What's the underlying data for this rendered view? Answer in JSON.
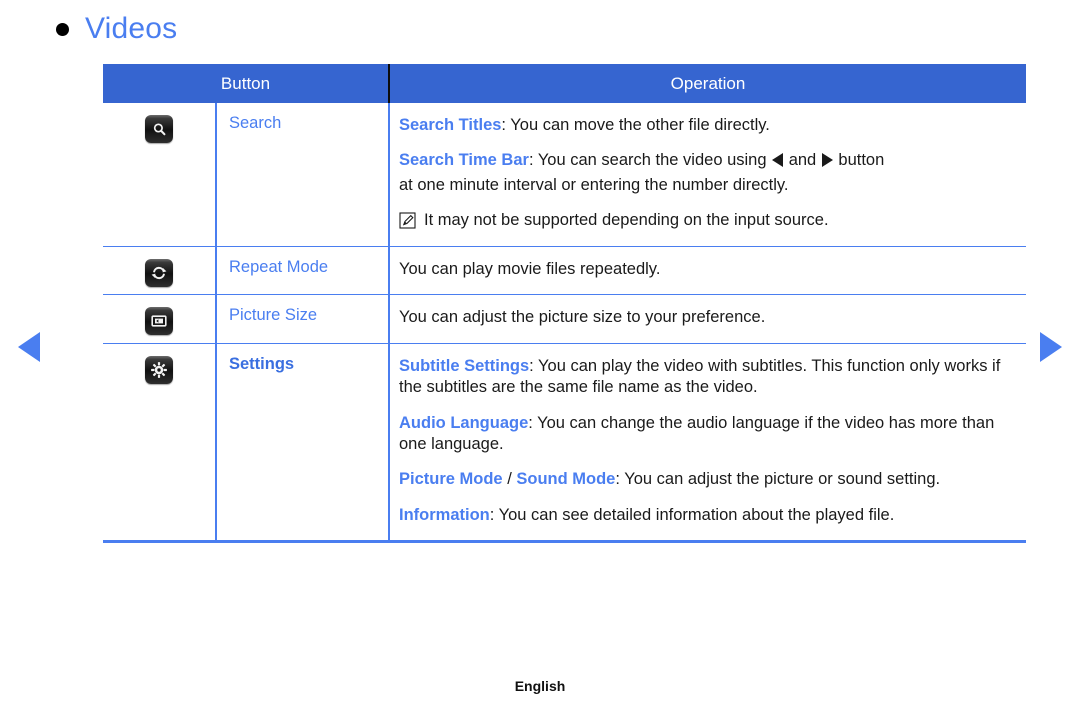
{
  "page": {
    "title": "Videos",
    "bullet_icon": "bullet-dot",
    "footer_label": "English",
    "accent_color": "#4a7ef0",
    "header_bg_color": "#3665d0",
    "header_text_color": "#ffffff",
    "body_text_color": "#1a1a1a"
  },
  "navigation": {
    "prev_icon": "triangle-left-icon",
    "next_icon": "triangle-right-icon"
  },
  "table": {
    "headers": {
      "button": "Button",
      "operation": "Operation"
    },
    "rows": [
      {
        "icon": "search-key-icon",
        "name": "Search",
        "lines": [
          {
            "key": "Search Titles",
            "sep": ": ",
            "text": "You can move the other file directly."
          },
          {
            "key": "Search Time Bar",
            "sep": ": ",
            "text_before": "You can search the video using ",
            "text_mid": " and ",
            "text_after": " button",
            "arrow_left": "triangle-left-inline-icon",
            "arrow_right": "triangle-right-inline-icon"
          },
          {
            "text": "at one minute interval or entering the number directly."
          }
        ],
        "note": {
          "icon": "note-pencil-icon",
          "text": "It may not be supported depending on the input source."
        }
      },
      {
        "icon": "repeat-key-icon",
        "name": "Repeat Mode",
        "lines": [
          {
            "text": "You can play movie files repeatedly."
          }
        ]
      },
      {
        "icon": "picture-size-key-icon",
        "name": "Picture Size",
        "lines": [
          {
            "text": "You can adjust the picture size to your preference."
          }
        ]
      },
      {
        "icon": "settings-gear-key-icon",
        "name": "Settings",
        "name_emphasis": true,
        "lines": [
          {
            "key": "Subtitle Settings",
            "sep": ": ",
            "text": "You can play the video with subtitles. This function only works if the subtitles are the same file name as the video."
          },
          {
            "key": "Audio Language",
            "sep": ": ",
            "text": "You can change the audio language if the video has more than one language."
          },
          {
            "key": "Picture Mode",
            "key2": "Sound Mode",
            "slash": " / ",
            "sep": ": ",
            "text": "You can adjust the picture or sound setting."
          },
          {
            "key": "Information",
            "sep": ": ",
            "text": "You can see detailed information about the played file."
          }
        ]
      }
    ]
  }
}
